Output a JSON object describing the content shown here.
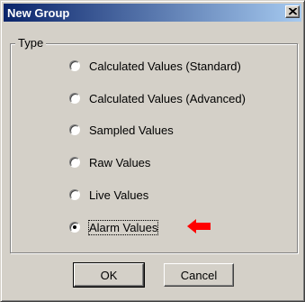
{
  "window": {
    "title": "New Group",
    "close_label": "close"
  },
  "group": {
    "legend": "Type",
    "options": [
      {
        "label": "Calculated Values (Standard)",
        "checked": false
      },
      {
        "label": "Calculated Values (Advanced)",
        "checked": false
      },
      {
        "label": "Sampled Values",
        "checked": false
      },
      {
        "label": "Raw Values",
        "checked": false
      },
      {
        "label": "Live Values",
        "checked": false
      },
      {
        "label": "Alarm Values",
        "checked": true
      }
    ]
  },
  "buttons": {
    "ok": "OK",
    "cancel": "Cancel"
  },
  "annotation": {
    "arrow_icon": "left-arrow-icon",
    "arrow_color": "#ff0000"
  },
  "colors": {
    "title_start": "#0a246a",
    "title_end": "#a6caf0",
    "face": "#d4d0c8"
  }
}
